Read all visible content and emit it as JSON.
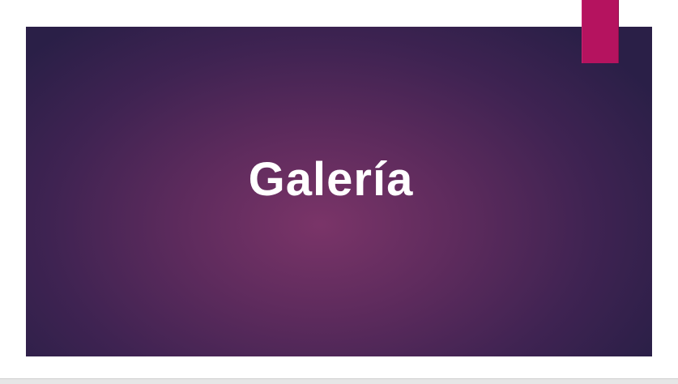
{
  "slide": {
    "title": "Galería"
  },
  "colors": {
    "background_center": "#7a3468",
    "background_edge": "#2a1f47",
    "accent": "#b5135f",
    "title_text": "#ffffff"
  }
}
